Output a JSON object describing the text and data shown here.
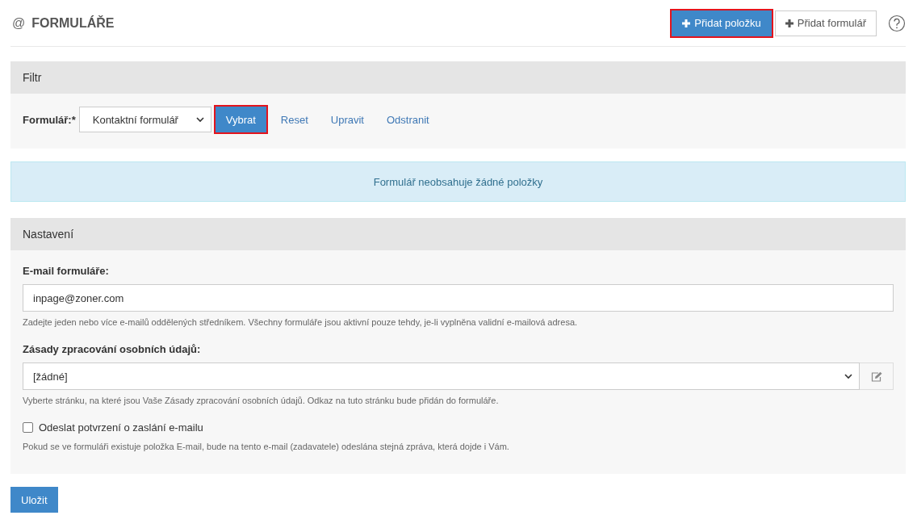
{
  "header": {
    "icon": "@",
    "title": "FORMULÁŘE",
    "buttons": [
      {
        "label": "Přidat položku",
        "kind": "primary",
        "highlighted": true
      },
      {
        "label": "Přidat formulář",
        "kind": "default",
        "highlighted": false
      }
    ]
  },
  "filter": {
    "title": "Filtr",
    "label": "Formulář:*",
    "select_value": "Kontaktní formulář",
    "button": {
      "label": "Vybrat",
      "kind": "primary",
      "highlighted": true
    },
    "links": [
      "Reset",
      "Upravit",
      "Odstranit"
    ]
  },
  "alert": "Formulář neobsahuje žádné položky",
  "settings": {
    "title": "Nastavení",
    "fields": [
      {
        "kind": "input",
        "label": "E-mail formuláře:",
        "value": "inpage@zoner.com",
        "help": "Zadejte jeden nebo více e-mailů oddělených středníkem. Všechny formuláře jsou aktivní pouze tehdy, je-li vyplněna validní e-mailová adresa."
      },
      {
        "kind": "select",
        "label": "Zásady zpracování osobních údajů:",
        "value": "[žádné]",
        "help": "Vyberte stránku, na které jsou Vaše Zásady zpracování osobních údajů. Odkaz na tuto stránku bude přidán do formuláře."
      },
      {
        "kind": "checkbox",
        "label": "Odeslat potvrzení o zaslání e-mailu",
        "checked": false,
        "help": "Pokud se ve formuláři existuje položka E-mail, bude na tento e-mail (zadavatele) odeslána stejná zpráva, která dojde i Vám."
      }
    ]
  },
  "save_button": {
    "label": "Uložit",
    "kind": "primary",
    "highlighted": false
  }
}
